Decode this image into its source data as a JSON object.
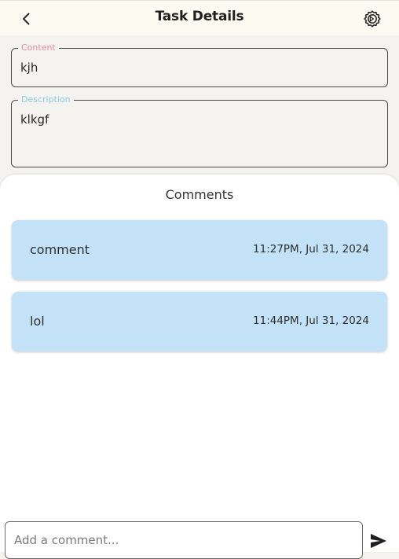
{
  "app_bar": {
    "title": "Task Details",
    "back_icon": "chevron-left-icon",
    "settings_icon": "gear-icon"
  },
  "task": {
    "content_label": "Content",
    "content_value": "kjh",
    "description_label": "Description",
    "description_value": "klkgf"
  },
  "comments": {
    "title": "Comments",
    "items": [
      {
        "text": "comment",
        "timestamp": "11:27PM, Jul 31, 2024"
      },
      {
        "text": "lol",
        "timestamp": "11:44PM, Jul 31, 2024"
      }
    ]
  },
  "composer": {
    "placeholder": "Add a comment...",
    "value": "",
    "send_icon": "send-icon"
  },
  "colors": {
    "app_bar_bg": "#fdfbf1",
    "page_bg": "#f4f3ef",
    "content_label": "#e98aa7",
    "description_label": "#8ccbe6",
    "comment_card_bg": "#c3e2f7"
  }
}
